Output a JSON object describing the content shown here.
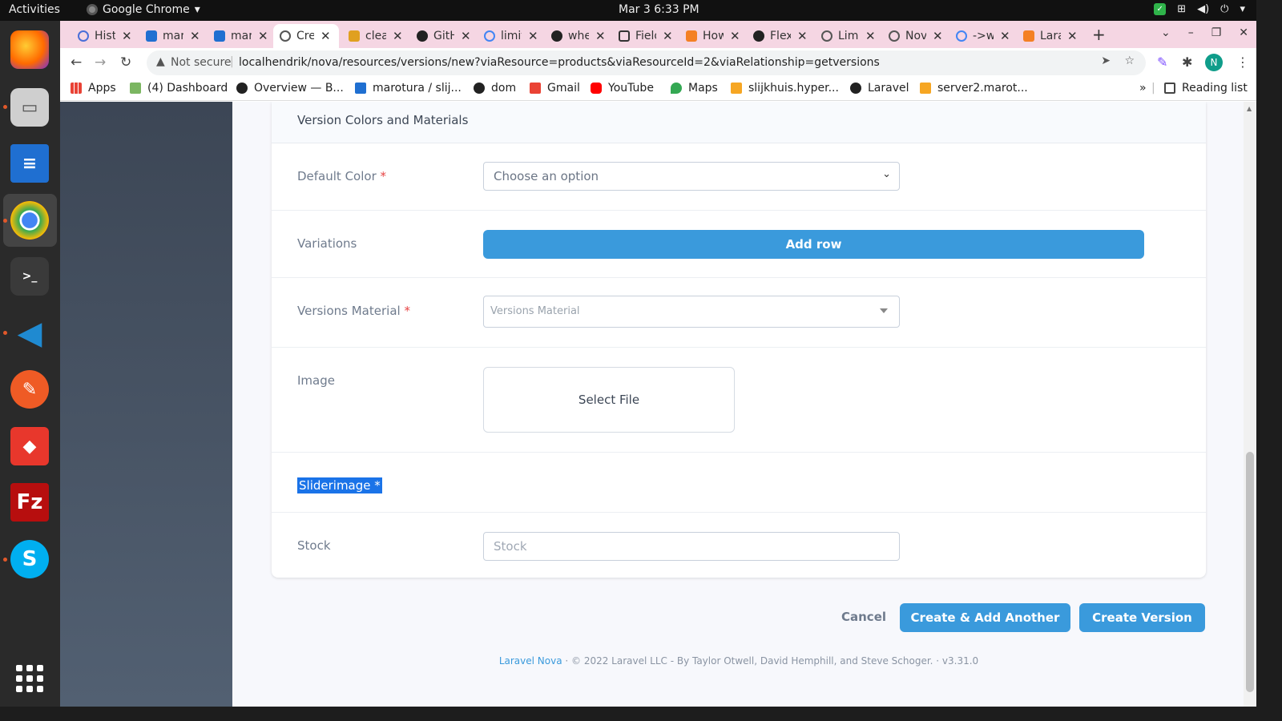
{
  "topbar": {
    "activities": "Activities",
    "app_name": "Google Chrome",
    "app_menu_arrow": "▾",
    "clock": "Mar 3  6:33 PM"
  },
  "tabs": [
    {
      "label": "History",
      "icon_color": "#4a6fd8"
    },
    {
      "label": "marotura",
      "icon_color": "#1f6fd1"
    },
    {
      "label": "marotura",
      "icon_color": "#1f6fd1"
    },
    {
      "label": "Create Version",
      "icon_color": "#555555",
      "active": true
    },
    {
      "label": "clear",
      "icon_color": "#e0a020"
    },
    {
      "label": "GitHub",
      "icon_color": "#222222"
    },
    {
      "label": "limit",
      "icon_color": "#4285f4"
    },
    {
      "label": "where",
      "icon_color": "#222222"
    },
    {
      "label": "Field",
      "icon_color": "#333333"
    },
    {
      "label": "How",
      "icon_color": "#f48024"
    },
    {
      "label": "Flex",
      "icon_color": "#222222"
    },
    {
      "label": "Limit",
      "icon_color": "#555555"
    },
    {
      "label": "Nova",
      "icon_color": "#555555"
    },
    {
      "label": "->with",
      "icon_color": "#4285f4"
    },
    {
      "label": "Laravel",
      "icon_color": "#f48024"
    }
  ],
  "omnibox": {
    "security": "Not secure",
    "url": "localhendrik/nova/resources/versions/new?viaResource=products&viaResourceId=2&viaRelationship=getversions"
  },
  "profile_initial": "N",
  "bookmarks": {
    "items": [
      {
        "label": "Apps",
        "icon_color": "#e94235"
      },
      {
        "label": "(4) Dashboard",
        "icon_color": "#7bb661"
      },
      {
        "label": "Overview — B...",
        "icon_color": "#222222"
      },
      {
        "label": "marotura / slij...",
        "icon_color": "#1f6fd1"
      },
      {
        "label": "dom",
        "icon_color": "#222222"
      },
      {
        "label": "Gmail",
        "icon_color": "#ea4335"
      },
      {
        "label": "YouTube",
        "icon_color": "#ff0000"
      },
      {
        "label": "Maps",
        "icon_color": "#34a853"
      },
      {
        "label": "slijkhuis.hyper...",
        "icon_color": "#f6a623"
      },
      {
        "label": "Laravel",
        "icon_color": "#222222"
      },
      {
        "label": "server2.marot...",
        "icon_color": "#f6a623"
      }
    ],
    "more": "»",
    "reading_list": "Reading list"
  },
  "form": {
    "section_title": "Version Colors and Materials",
    "default_color_label": "Default Color",
    "default_color_placeholder": "Choose an option",
    "variations_label": "Variations",
    "add_row_label": "Add row",
    "versions_material_label": "Versions Material",
    "versions_material_placeholder": "Versions Material",
    "image_label": "Image",
    "select_file_label": "Select File",
    "sliderimage_label": "Sliderimage *",
    "stock_label": "Stock",
    "stock_placeholder": "Stock",
    "required_mark": "*"
  },
  "actions": {
    "cancel": "Cancel",
    "create_add_another": "Create & Add Another",
    "create_version": "Create Version"
  },
  "footer": {
    "link": "Laravel Nova",
    "text": "·  © 2022 Laravel LLC - By Taylor Otwell, David Hemphill, and Steve Schoger.  ·  v3.31.0"
  },
  "colors": {
    "accent": "#3a9adc",
    "required": "#e74444",
    "selection": "#1a73e8"
  }
}
